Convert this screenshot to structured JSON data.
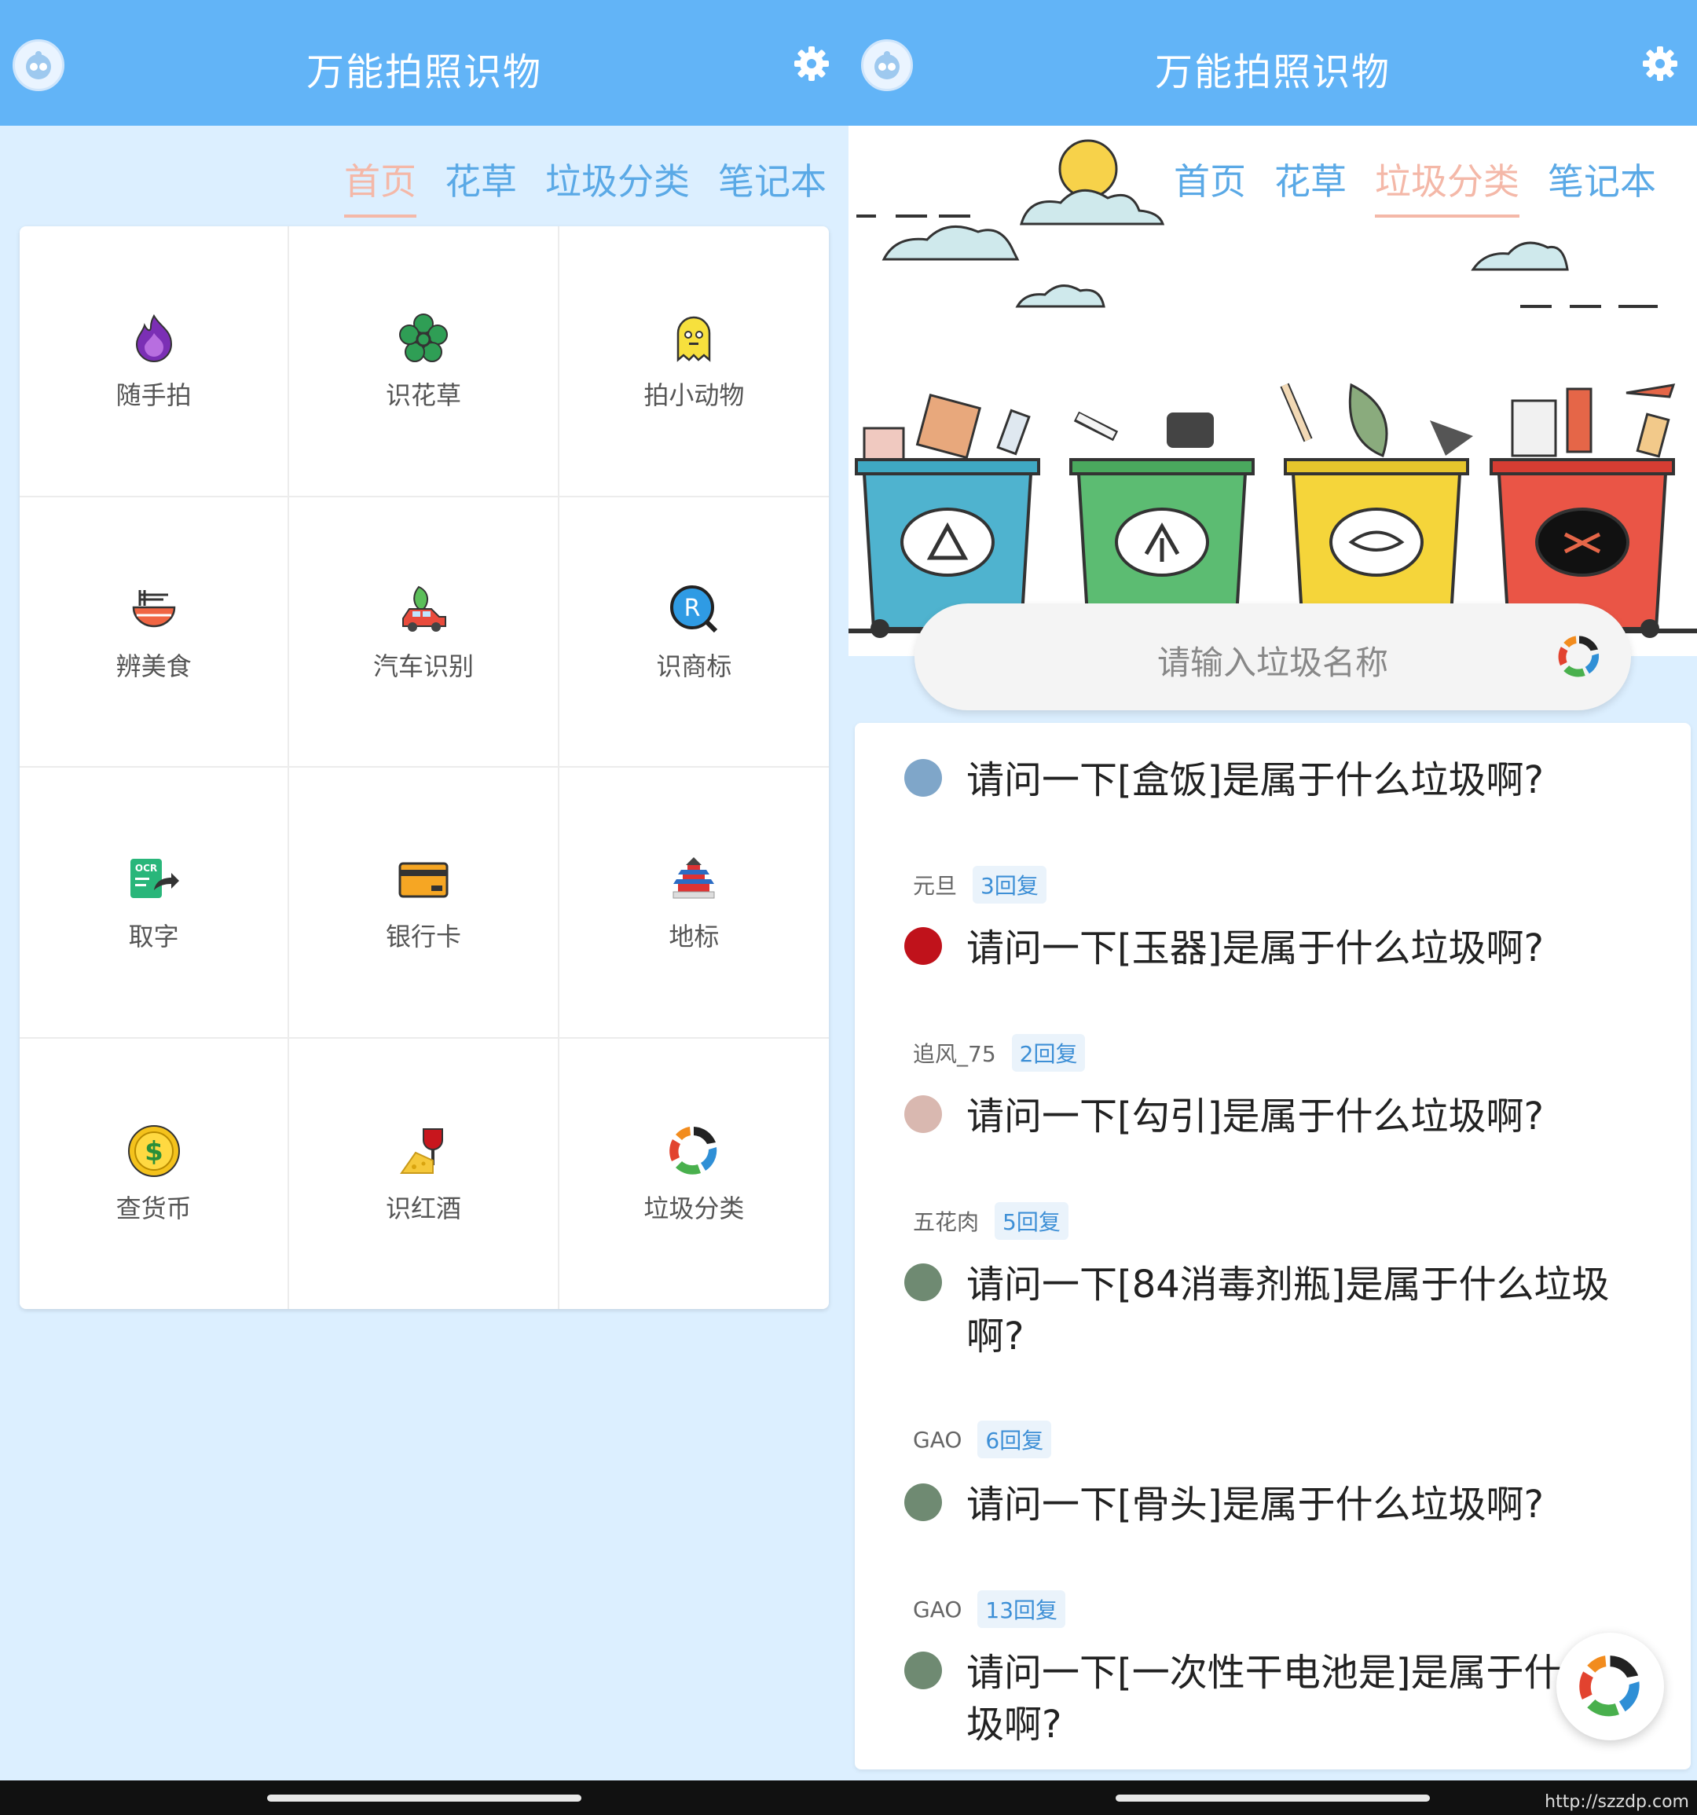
{
  "left": {
    "app_title": "万能拍照识物",
    "tabs": [
      "首页",
      "花草",
      "垃圾分类",
      "笔记本"
    ],
    "active_tab": "首页",
    "grid": [
      {
        "label": "随手拍",
        "icon": "fire-icon"
      },
      {
        "label": "识花草",
        "icon": "flower-icon"
      },
      {
        "label": "拍小动物",
        "icon": "ghost-icon"
      },
      {
        "label": "辨美食",
        "icon": "noodle-bowl-icon"
      },
      {
        "label": "汽车识别",
        "icon": "car-icon"
      },
      {
        "label": "识商标",
        "icon": "trademark-icon"
      },
      {
        "label": "取字",
        "icon": "ocr-icon"
      },
      {
        "label": "银行卡",
        "icon": "bank-card-icon"
      },
      {
        "label": "地标",
        "icon": "temple-icon"
      },
      {
        "label": "查货币",
        "icon": "dollar-coin-icon"
      },
      {
        "label": "识红酒",
        "icon": "wine-cheese-icon"
      },
      {
        "label": "垃圾分类",
        "icon": "recycle-icon"
      }
    ]
  },
  "right": {
    "app_title": "万能拍照识物",
    "tabs": [
      "首页",
      "花草",
      "垃圾分类",
      "笔记本"
    ],
    "active_tab": "垃圾分类",
    "search": {
      "placeholder": "请输入垃圾名称"
    },
    "posts": [
      {
        "title": "请问一下[盒饭]是属于什么垃圾啊?",
        "author": "元旦",
        "replies": "3回复",
        "avatar_color": "#7fa6c9"
      },
      {
        "title": "请问一下[玉器]是属于什么垃圾啊?",
        "author": "追风_75",
        "replies": "2回复",
        "avatar_color": "#c0121b"
      },
      {
        "title": "请问一下[勾引]是属于什么垃圾啊?",
        "author": "五花肉",
        "replies": "5回复",
        "avatar_color": "#d9b8b0"
      },
      {
        "title": "请问一下[84消毒剂瓶]是属于什么垃圾啊?",
        "author": "GAO",
        "replies": "6回复",
        "avatar_color": "#6f8a72"
      },
      {
        "title": "请问一下[骨头]是属于什么垃圾啊?",
        "author": "GAO",
        "replies": "13回复",
        "avatar_color": "#6f8a72"
      },
      {
        "title": "请问一下[一次性干电池是]是属于什么垃圾啊?",
        "author": "",
        "replies": "",
        "avatar_color": "#6f8a72"
      }
    ]
  },
  "watermark": "http://szzdp.com"
}
